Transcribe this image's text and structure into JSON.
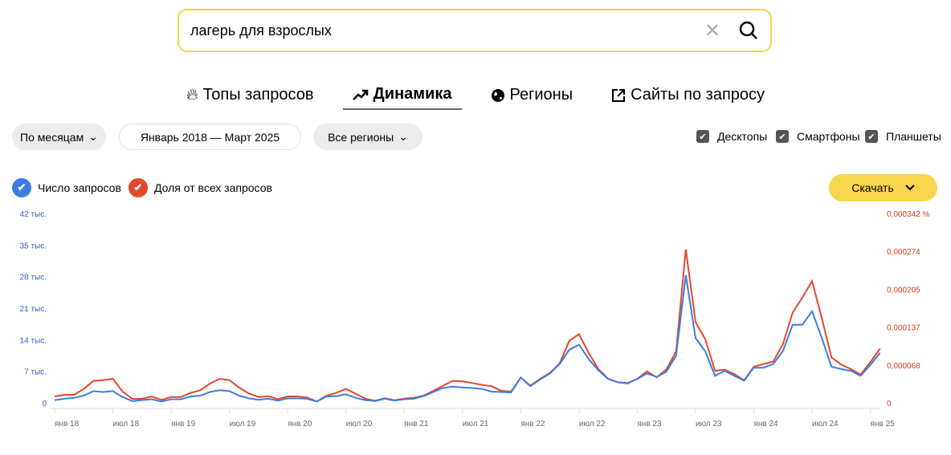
{
  "search": {
    "value": "лагерь для взрослых"
  },
  "tabs": [
    {
      "label": "Топы запросов",
      "icon": "fire-icon"
    },
    {
      "label": "Динамика",
      "icon": "trend-icon",
      "active": true
    },
    {
      "label": "Регионы",
      "icon": "globe-icon"
    },
    {
      "label": "Сайты по запросу",
      "icon": "external-link-icon"
    }
  ],
  "filters": {
    "period": "По месяцам",
    "range": "Январь 2018 — Март 2025",
    "region": "Все регионы"
  },
  "devices": [
    {
      "label": "Десктопы",
      "checked": true
    },
    {
      "label": "Смартфоны",
      "checked": true
    },
    {
      "label": "Планшеты",
      "checked": true
    }
  ],
  "download": "Скачать",
  "colors": {
    "blue": "#3d7de0",
    "red": "#e3482c",
    "accent": "#f7d54c"
  },
  "chart_data": {
    "type": "line",
    "x_start": "янв 18",
    "x_step": "month",
    "legend": [
      "Число запросов",
      "Доля от всех запросов"
    ],
    "x_ticks": [
      {
        "i": 0,
        "label": "янв 18"
      },
      {
        "i": 6,
        "label": "июл 18"
      },
      {
        "i": 12,
        "label": "янв 19"
      },
      {
        "i": 18,
        "label": "июл 19"
      },
      {
        "i": 24,
        "label": "янв 20"
      },
      {
        "i": 30,
        "label": "июл 20"
      },
      {
        "i": 36,
        "label": "янв 21"
      },
      {
        "i": 42,
        "label": "июл 21"
      },
      {
        "i": 48,
        "label": "янв 22"
      },
      {
        "i": 54,
        "label": "июл 22"
      },
      {
        "i": 60,
        "label": "янв 23"
      },
      {
        "i": 66,
        "label": "июл 23"
      },
      {
        "i": 72,
        "label": "янв 24"
      },
      {
        "i": 78,
        "label": "июл 24"
      },
      {
        "i": 84,
        "label": "янв 25"
      }
    ],
    "left_axis": {
      "ticks": [
        "0",
        "7 тыс.",
        "14 тыс.",
        "21 тыс.",
        "28 тыс.",
        "35 тыс.",
        "42 тыс."
      ],
      "ylim": [
        0,
        42000
      ]
    },
    "right_axis": {
      "ticks": [
        "0",
        "0,000068",
        "0,000137",
        "0,000205",
        "0,000274",
        "0,000342 %"
      ],
      "ylim": [
        0,
        0.000342
      ]
    },
    "series": [
      {
        "name": "Число запросов",
        "unit": "тыс.",
        "values": [
          0.6,
          0.9,
          1.1,
          1.6,
          2.6,
          2.4,
          2.6,
          1.3,
          0.4,
          0.6,
          0.8,
          0.3,
          0.8,
          0.8,
          1.4,
          1.6,
          2.4,
          2.8,
          2.6,
          1.6,
          1.0,
          0.7,
          0.9,
          0.5,
          1.0,
          1.0,
          0.9,
          0.3,
          1.4,
          1.5,
          1.9,
          1.1,
          0.6,
          0.4,
          0.9,
          0.5,
          0.8,
          0.9,
          1.5,
          2.4,
          3.3,
          3.6,
          3.4,
          3.3,
          3.1,
          2.5,
          2.4,
          2.3,
          5.6,
          3.7,
          5.2,
          6.5,
          8.6,
          11.8,
          12.9,
          9.7,
          7.2,
          5.3,
          4.6,
          4.4,
          5.3,
          6.5,
          5.75,
          6.9,
          10.5,
          28.3,
          14.4,
          11.4,
          6.0,
          7.1,
          6.0,
          4.9,
          7.8,
          7.8,
          8.6,
          11.5,
          17.3,
          17.3,
          20.3,
          14.4,
          8.0,
          7.5,
          7.1,
          6.0,
          8.4,
          11.1
        ]
      },
      {
        "name": "Доля от всех запросов",
        "unit": "millionths of %",
        "values": [
          11.6,
          14.5,
          14.5,
          25,
          39.7,
          41,
          43.5,
          20.3,
          7.3,
          7.3,
          11.6,
          5.3,
          10.6,
          10.6,
          17.9,
          22.7,
          34.8,
          43.5,
          41,
          27.6,
          17,
          10.6,
          12,
          6.8,
          11.6,
          11.6,
          9.7,
          2.4,
          13,
          17.9,
          25,
          16.4,
          7.7,
          3.9,
          8.2,
          4.8,
          7.7,
          9.2,
          13,
          21.8,
          31,
          39.7,
          38.7,
          35.8,
          32.4,
          30,
          21.8,
          20.3,
          45.5,
          31,
          43.5,
          54,
          71,
          112,
          124,
          90,
          61,
          43.5,
          37,
          35,
          43.5,
          57,
          46,
          60.5,
          93,
          277,
          146,
          115,
          58,
          60,
          52,
          40.6,
          65,
          70,
          74.5,
          106,
          163,
          190,
          220,
          153,
          82,
          69,
          61,
          51,
          73.5,
          98
        ]
      }
    ]
  }
}
